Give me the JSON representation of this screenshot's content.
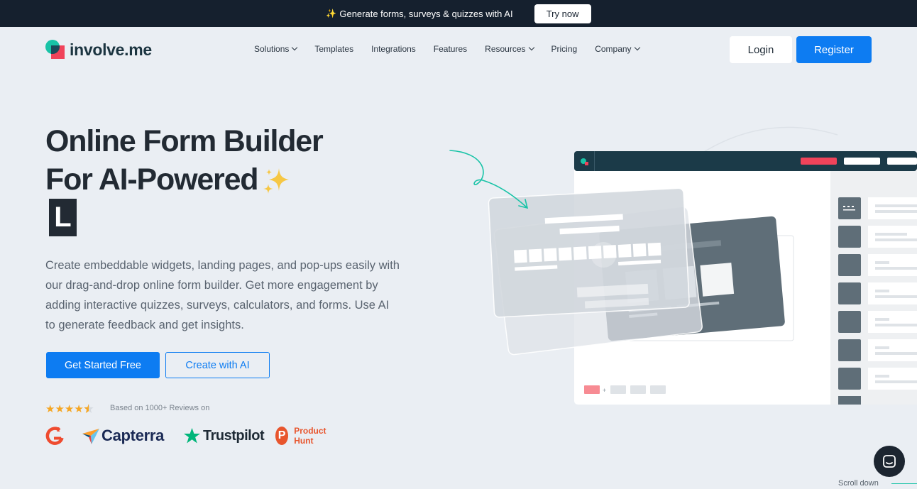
{
  "announcement": {
    "text": "Generate forms, surveys & quizzes with AI",
    "sparkle_icon": "sparkle-icon",
    "cta": "Try now"
  },
  "brand": {
    "name": "involve.me",
    "colors": {
      "teal": "#19c3a7",
      "red": "#f0435a",
      "dark": "#1b4a5a"
    }
  },
  "nav": {
    "items": [
      {
        "label": "Solutions",
        "dropdown": true
      },
      {
        "label": "Templates",
        "dropdown": false
      },
      {
        "label": "Integrations",
        "dropdown": false
      },
      {
        "label": "Features",
        "dropdown": false
      },
      {
        "label": "Resources",
        "dropdown": true
      },
      {
        "label": "Pricing",
        "dropdown": false
      },
      {
        "label": "Company",
        "dropdown": true
      }
    ],
    "login": "Login",
    "register": "Register"
  },
  "hero": {
    "title_line1": "Online Form Builder",
    "title_line2": "For AI-Powered",
    "typing_letter": "L",
    "description": "Create embeddable widgets, landing pages, and pop-ups easily with our drag-and-drop online form builder. Get more engagement by adding interactive quizzes, surveys, calculators, and forms. Use AI to generate feedback and get insights.",
    "primary_cta": "Get Started Free",
    "secondary_cta": "Create with AI"
  },
  "reviews": {
    "rating": 4.5,
    "text": "Based on 1000+ Reviews on",
    "platforms": [
      "G2",
      "Capterra",
      "Trustpilot",
      "Product Hunt"
    ]
  },
  "footer_hint": {
    "scroll_label": "Scroll down",
    "chat_icon": "chat-icon"
  },
  "colors": {
    "primary": "#0d7cf2",
    "topbar": "#15202e",
    "background": "#eaeef3",
    "editor_header": "#1b3a48",
    "editor_accent": "#f0435a"
  }
}
